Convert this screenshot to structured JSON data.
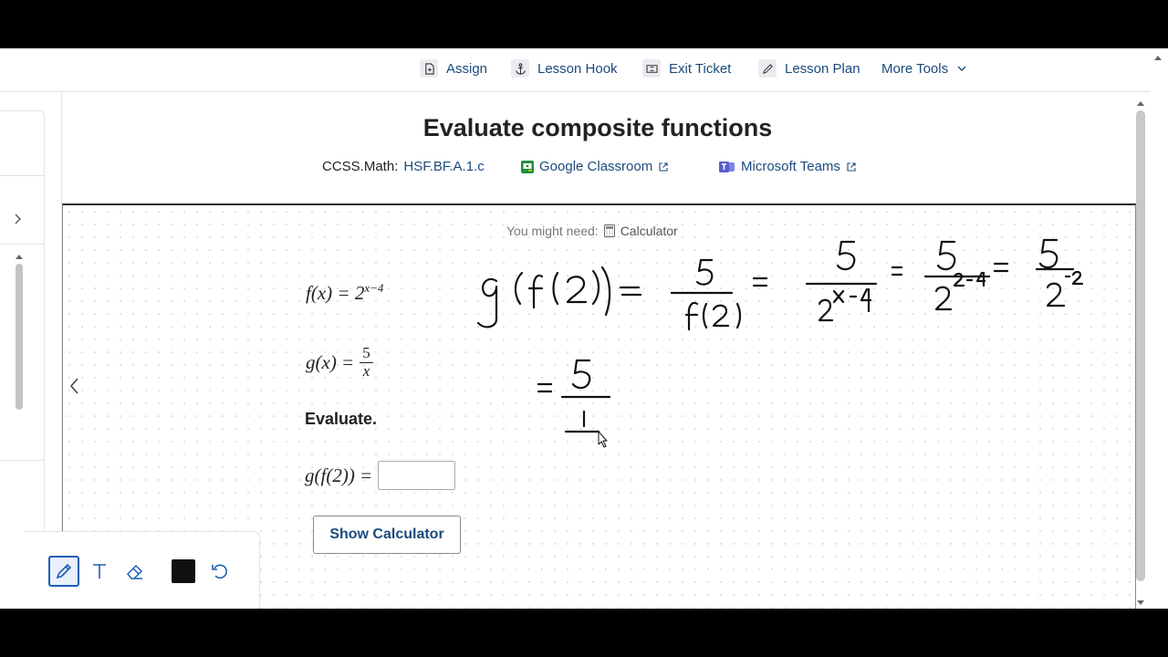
{
  "toolbar": {
    "assign": "Assign",
    "lesson_hook": "Lesson Hook",
    "exit_ticket": "Exit Ticket",
    "lesson_plan": "Lesson Plan",
    "more_tools": "More Tools"
  },
  "header": {
    "title": "Evaluate composite functions",
    "standard_prefix": "CCSS.Math:",
    "standard_code": "HSF.BF.A.1.c",
    "google_classroom": "Google Classroom",
    "microsoft_teams": "Microsoft Teams"
  },
  "problem": {
    "might_need_label": "You might need:",
    "calculator_label": "Calculator",
    "f_def": "f(x) = 2",
    "f_exponent": "x−4",
    "g_lhs": "g(x) =",
    "g_num": "5",
    "g_den": "x",
    "evaluate_label": "Evaluate.",
    "question_lhs": "g(f(2)) =",
    "answer_value": "",
    "show_calculator": "Show Calculator"
  },
  "colors": {
    "link": "#1c4a7c",
    "google_green": "#1e8e3e",
    "teams_purple": "#5b5fc7",
    "active_tool": "#1c5fb5",
    "pen_color": "#111111"
  },
  "icons": [
    "assign-icon",
    "anchor-icon",
    "ticket-icon",
    "pencil-icon",
    "chevron-down-icon",
    "external-link-icon",
    "calculator-icon",
    "chevron-left-icon",
    "chevron-right-icon",
    "pen-tool-icon",
    "text-tool-icon",
    "eraser-icon",
    "undo-icon"
  ]
}
